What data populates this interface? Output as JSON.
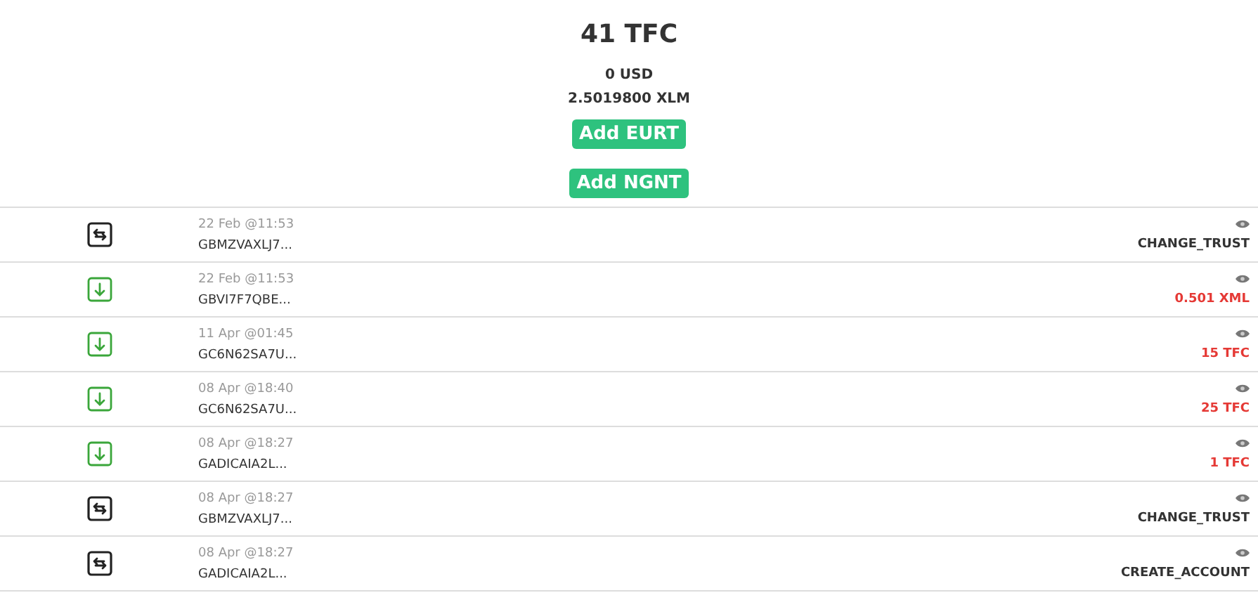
{
  "balance": {
    "title": "41 TFC",
    "usd": "0 USD",
    "xlm": "2.5019800 XLM"
  },
  "buttons": [
    "Add EURT",
    "Add NGNT"
  ],
  "transactions": [
    {
      "kind": "trust",
      "time": "22 Feb @11:53",
      "account": "GBMZVAXLJ7...",
      "value": "CHANGE_TRUST"
    },
    {
      "kind": "receive",
      "time": "22 Feb @11:53",
      "account": "GBVI7F7QBE...",
      "value": "0.501 XML"
    },
    {
      "kind": "receive",
      "time": "11 Apr @01:45",
      "account": "GC6N62SA7U...",
      "value": "15 TFC"
    },
    {
      "kind": "receive",
      "time": "08 Apr @18:40",
      "account": "GC6N62SA7U...",
      "value": "25 TFC"
    },
    {
      "kind": "receive",
      "time": "08 Apr @18:27",
      "account": "GADICAIA2L...",
      "value": "1 TFC"
    },
    {
      "kind": "trust",
      "time": "08 Apr @18:27",
      "account": "GBMZVAXLJ7...",
      "value": "CHANGE_TRUST"
    },
    {
      "kind": "trust",
      "time": "08 Apr @18:27",
      "account": "GADICAIA2L...",
      "value": "CREATE_ACCOUNT"
    }
  ]
}
